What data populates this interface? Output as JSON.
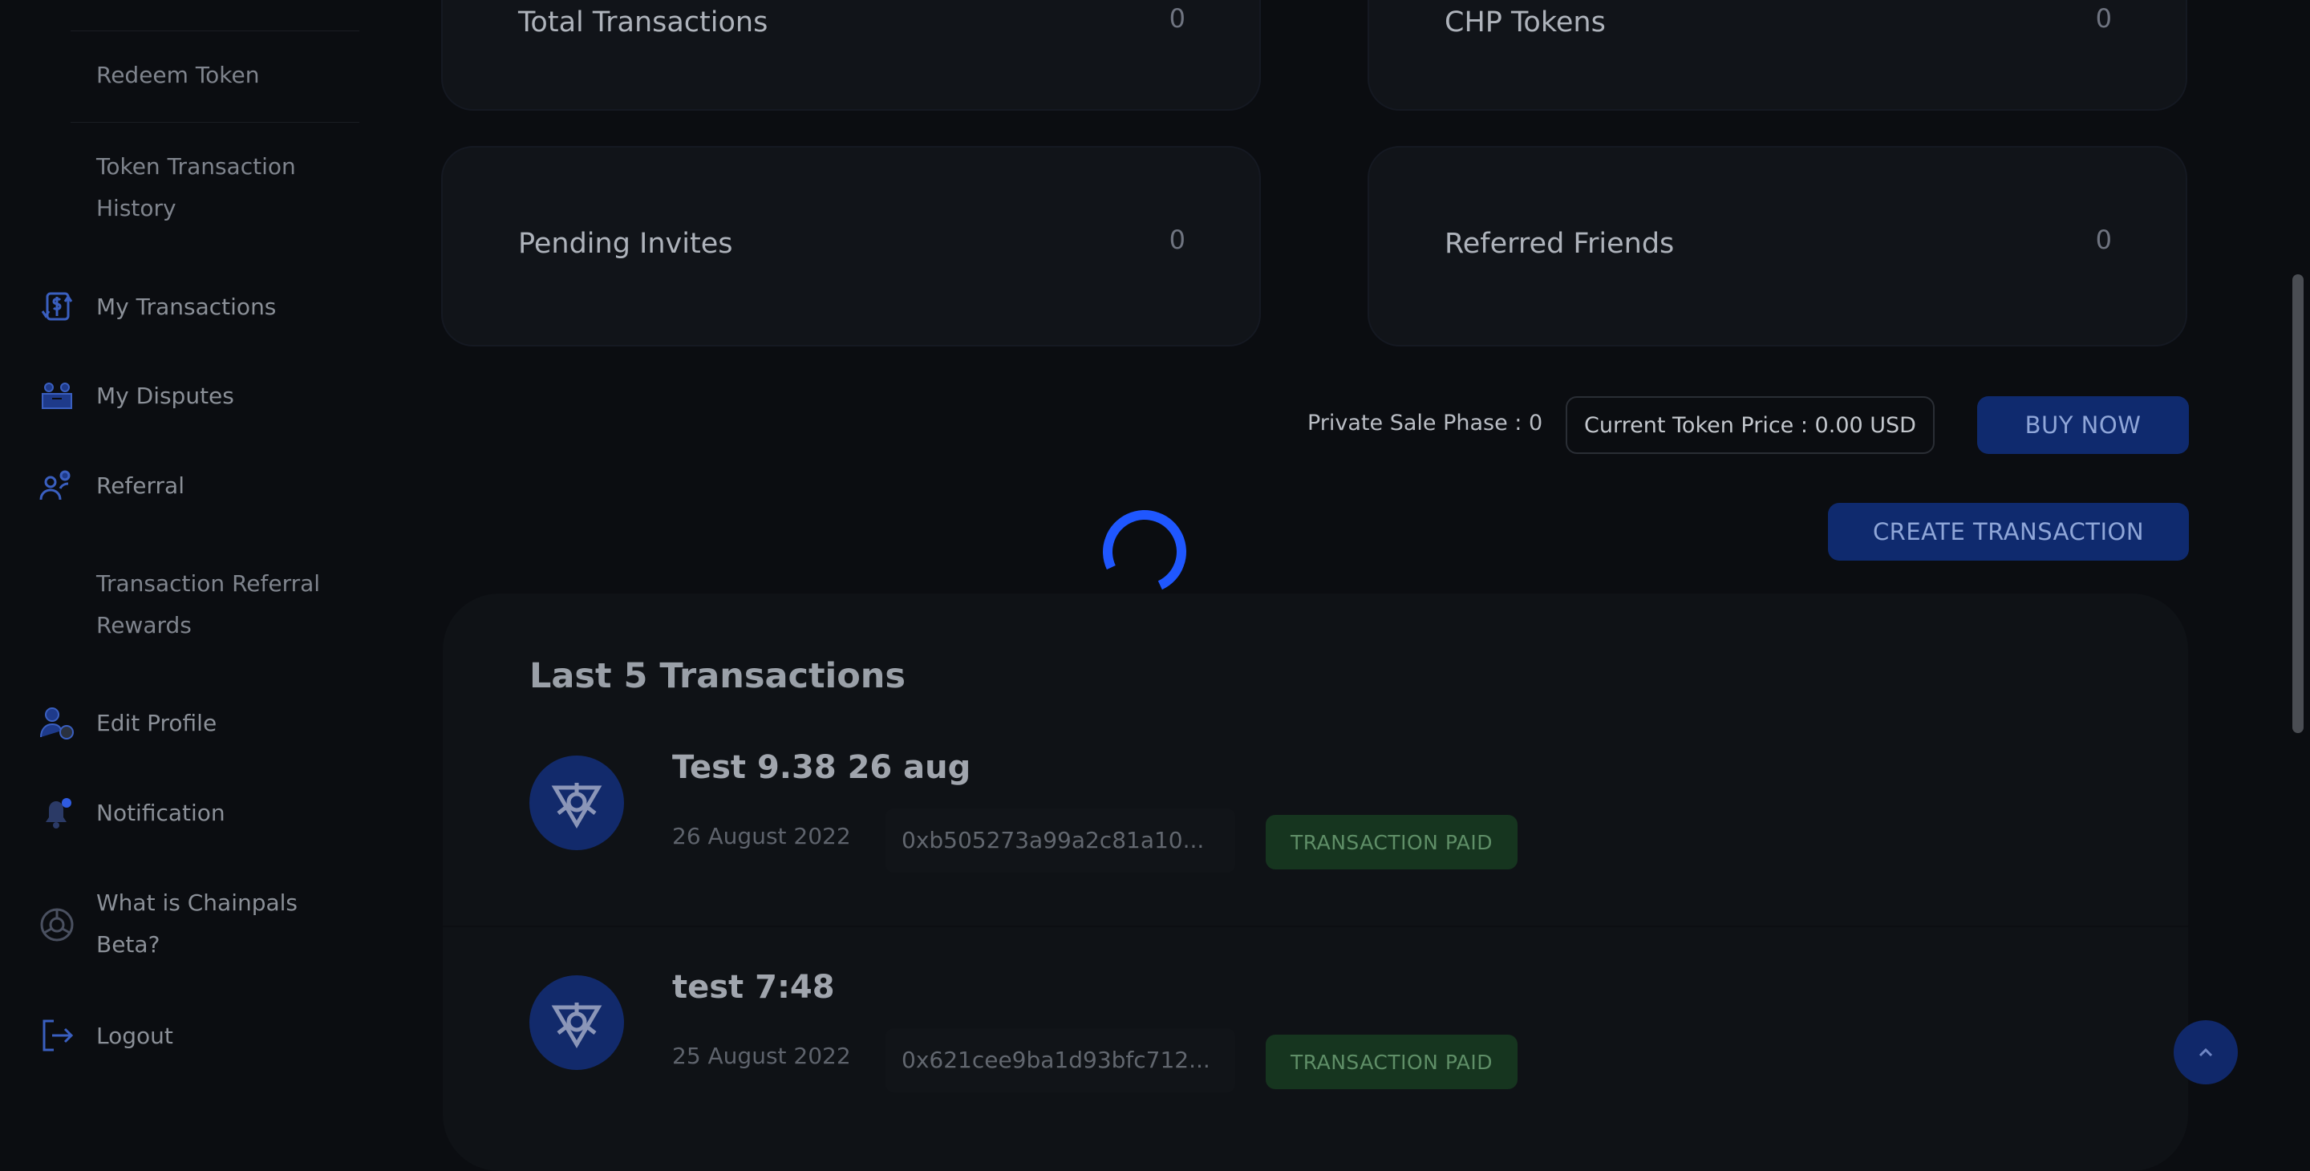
{
  "sidebar": {
    "redeem_token": "Redeem Token",
    "token_tx_history": [
      "Token Transaction",
      "History"
    ],
    "my_transactions": "My Transactions",
    "my_disputes": "My Disputes",
    "referral": "Referral",
    "tx_referral_rewards": [
      "Transaction Referral",
      "Rewards"
    ],
    "edit_profile": "Edit Profile",
    "notification": "Notification",
    "what_is": [
      "What is Chainpals",
      "Beta?"
    ],
    "logout": "Logout"
  },
  "stats": {
    "total_transactions": {
      "label": "Total Transactions",
      "value": "0"
    },
    "chp_tokens": {
      "label": "CHP Tokens",
      "value": "0"
    },
    "pending_invites": {
      "label": "Pending Invites",
      "value": "0"
    },
    "referred_friends": {
      "label": "Referred Friends",
      "value": "0"
    }
  },
  "sale": {
    "phase": "Private Sale Phase : 0",
    "price": "Current Token Price : 0.00 USD",
    "buy_label": "BUY NOW",
    "create_label": "CREATE TRANSACTION"
  },
  "transactions": {
    "heading": "Last 5 Transactions",
    "items": [
      {
        "title": "Test 9.38 26 aug",
        "date": "26 August 2022",
        "hash": "0xb505273a99a2c81a10...",
        "status": "TRANSACTION PAID"
      },
      {
        "title": "test 7:48",
        "date": "25 August 2022",
        "hash": "0x621cee9ba1d93bfc712...",
        "status": "TRANSACTION PAID"
      }
    ]
  },
  "colors": {
    "accent": "#1f57ff",
    "button_bg": "#0f2a6e",
    "status_paid_bg": "#16351f",
    "status_paid_text": "#5f8e67"
  }
}
